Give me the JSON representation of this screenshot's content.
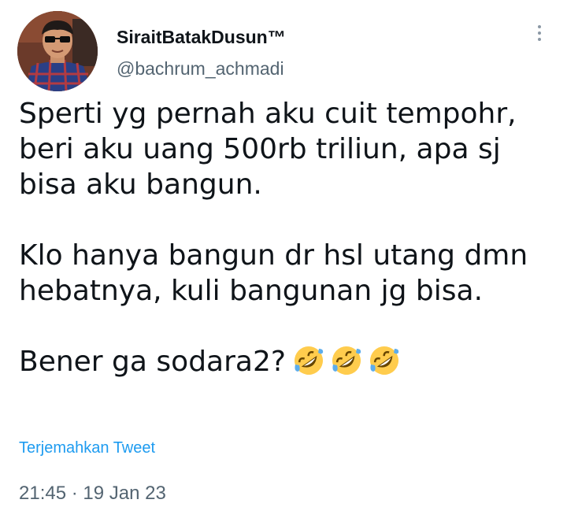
{
  "author": {
    "display_name": "SiraitBatakDusun™",
    "handle": "@bachrum_achmadi"
  },
  "tweet": {
    "lines": [
      "Sperti yg pernah aku cuit tempohr,",
      "beri aku uang 500rb triliun, apa sj",
      "bisa aku bangun."
    ],
    "lines2": [
      "Klo hanya bangun dr hsl utang dmn",
      "hebatnya, kuli bangunan jg bisa."
    ],
    "last_line": "Bener ga sodara2?",
    "emojis": [
      "rolling-on-floor-laughing",
      "rolling-on-floor-laughing",
      "rolling-on-floor-laughing"
    ]
  },
  "translate_link": "Terjemahkan Tweet",
  "timestamp": {
    "time": "21:45",
    "separator": "·",
    "date": "19 Jan 23"
  },
  "colors": {
    "link": "#1d9bf0",
    "secondary_text": "#536471",
    "primary_text": "#0f1419"
  }
}
